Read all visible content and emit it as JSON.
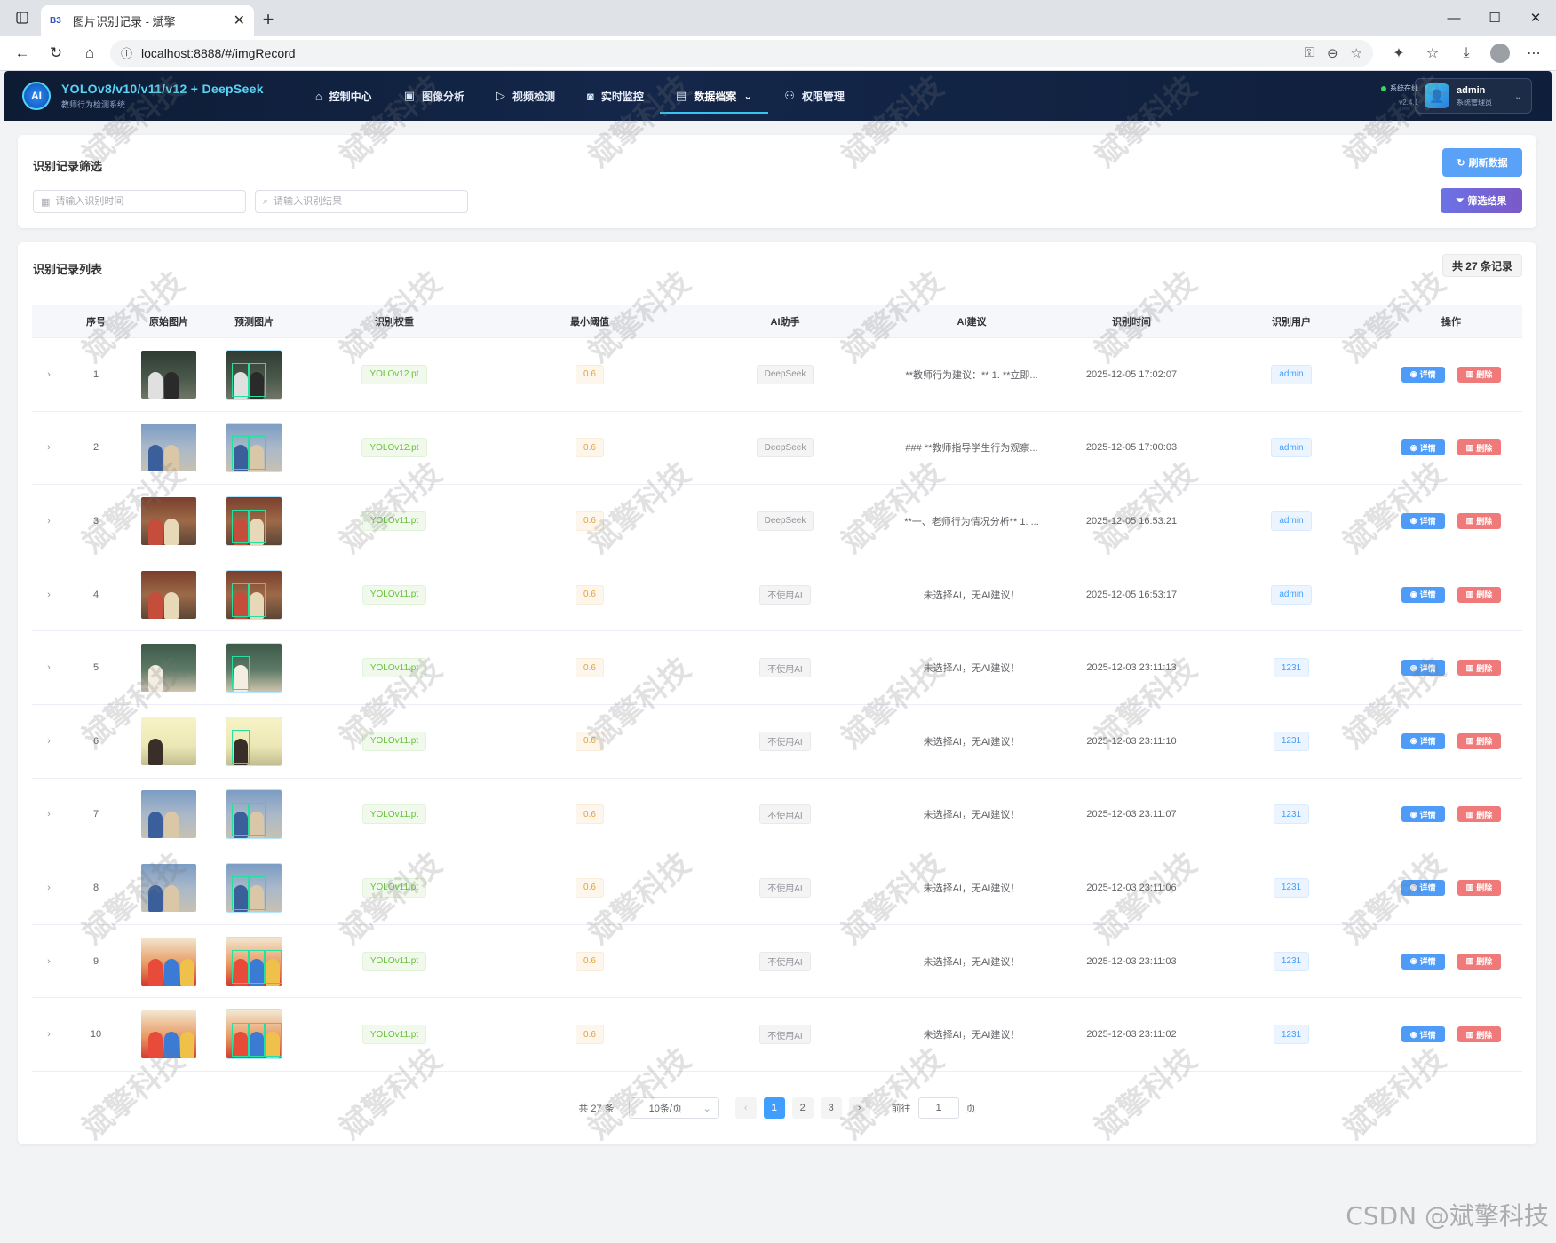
{
  "browser": {
    "tab_title": "图片识别记录 - 斌擎",
    "favicon_text": "B3",
    "url": "localhost:8888/#/imgRecord"
  },
  "header": {
    "logo_text": "AI",
    "title": "YOLOv8/v10/v11/v12 + DeepSeek",
    "subtitle": "教师行为检测系统",
    "menu": [
      {
        "label": "控制中心",
        "icon": "home-icon"
      },
      {
        "label": "图像分析",
        "icon": "image-icon"
      },
      {
        "label": "视频检测",
        "icon": "play-icon"
      },
      {
        "label": "实时监控",
        "icon": "camera-icon"
      },
      {
        "label": "数据档案",
        "icon": "document-icon",
        "active": true,
        "caret": "⌄"
      },
      {
        "label": "权限管理",
        "icon": "user-icon"
      }
    ],
    "status_text": "系统在线",
    "version": "v2.4.1",
    "user_name": "admin",
    "user_role": "系统管理员"
  },
  "filter": {
    "title": "识别记录筛选",
    "time_placeholder": "请输入识别时间",
    "result_placeholder": "请输入识别结果",
    "refresh_label": "刷新数据",
    "filter_label": "筛选结果"
  },
  "list": {
    "title": "识别记录列表",
    "count_label": "共 27 条记录",
    "columns": [
      "序号",
      "原始图片",
      "预测图片",
      "识别权重",
      "最小阈值",
      "AI助手",
      "AI建议",
      "识别时间",
      "识别用户",
      "操作"
    ],
    "detail_label": "详情",
    "delete_label": "删除",
    "rows": [
      {
        "idx": "1",
        "weight": "YOLOv12.pt",
        "conf": "0.6",
        "ai": "DeepSeek",
        "suggestion": "**教师行为建议：** 1. **立即...",
        "time": "2025-12-05 17:02:07",
        "user": "admin",
        "scene": "classroom-dark"
      },
      {
        "idx": "2",
        "weight": "YOLOv12.pt",
        "conf": "0.6",
        "ai": "DeepSeek",
        "suggestion": "### **教师指导学生行为观察...",
        "time": "2025-12-05 17:00:03",
        "user": "admin",
        "scene": "two-people"
      },
      {
        "idx": "3",
        "weight": "YOLOv11.pt",
        "conf": "0.6",
        "ai": "DeepSeek",
        "suggestion": "**一、老师行为情况分析** 1. ...",
        "time": "2025-12-05 16:53:21",
        "user": "admin",
        "scene": "library"
      },
      {
        "idx": "4",
        "weight": "YOLOv11.pt",
        "conf": "0.6",
        "ai": "不使用AI",
        "suggestion": "未选择AI，无AI建议！",
        "time": "2025-12-05 16:53:17",
        "user": "admin",
        "scene": "library"
      },
      {
        "idx": "5",
        "weight": "YOLOv11.pt",
        "conf": "0.6",
        "ai": "不使用AI",
        "suggestion": "未选择AI，无AI建议！",
        "time": "2025-12-03 23:11:13",
        "user": "1231",
        "scene": "chalkboard"
      },
      {
        "idx": "6",
        "weight": "YOLOv11.pt",
        "conf": "0.6",
        "ai": "不使用AI",
        "suggestion": "未选择AI，无AI建议！",
        "time": "2025-12-03 23:11:10",
        "user": "1231",
        "scene": "whiteboard"
      },
      {
        "idx": "7",
        "weight": "YOLOv11.pt",
        "conf": "0.6",
        "ai": "不使用AI",
        "suggestion": "未选择AI，无AI建议！",
        "time": "2025-12-03 23:11:07",
        "user": "1231",
        "scene": "two-people"
      },
      {
        "idx": "8",
        "weight": "YOLOv11.pt",
        "conf": "0.6",
        "ai": "不使用AI",
        "suggestion": "未选择AI，无AI建议！",
        "time": "2025-12-03 23:11:06",
        "user": "1231",
        "scene": "two-people"
      },
      {
        "idx": "9",
        "weight": "YOLOv11.pt",
        "conf": "0.6",
        "ai": "不使用AI",
        "suggestion": "未选择AI，无AI建议！",
        "time": "2025-12-03 23:11:03",
        "user": "1231",
        "scene": "kids"
      },
      {
        "idx": "10",
        "weight": "YOLOv11.pt",
        "conf": "0.6",
        "ai": "不使用AI",
        "suggestion": "未选择AI，无AI建议！",
        "time": "2025-12-03 23:11:02",
        "user": "1231",
        "scene": "kids"
      }
    ]
  },
  "pagination": {
    "total": "共 27 条",
    "page_size": "10条/页",
    "pages": [
      "1",
      "2",
      "3"
    ],
    "current": "1",
    "goto_prefix": "前往",
    "goto_value": "1",
    "goto_suffix": "页"
  },
  "watermark": "斌擎科技",
  "csdn_mark": "CSDN @斌擎科技",
  "colors": {
    "header_bg": "#0d1b33",
    "accent_cyan": "#59d4f5",
    "primary": "#409eff",
    "danger": "#f07a7a",
    "purple": "#7c58c8"
  }
}
